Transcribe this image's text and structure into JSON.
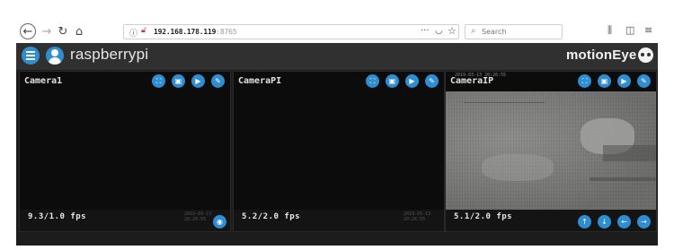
{
  "browser": {
    "url_host": "192.168.178.119",
    "url_port": ":8765",
    "url_more": "···",
    "search_placeholder": "Search",
    "icons": {
      "back": "arrow-left-icon",
      "forward": "arrow-right-icon",
      "reload": "reload-icon",
      "home": "home-icon",
      "info": "info-icon",
      "insecure": "insecure-lock-icon",
      "pocket": "pocket-icon",
      "bookmark": "star-icon",
      "library": "library-icon",
      "sidebar": "sidebar-icon",
      "menu": "hamburger-menu-icon"
    }
  },
  "header": {
    "hostname": "raspberrypi",
    "logo_text": "motionEye",
    "accent_color": "#2f8ed2",
    "background_color": "#303030"
  },
  "cameras": [
    {
      "name": "Camera1",
      "fps": "9.3/1.0 fps",
      "timestamp": "2019-03-13 20:26:55",
      "top_buttons": [
        "fullscreen-icon",
        "pictures-icon",
        "play-icon",
        "settings-icon"
      ],
      "bottom_buttons": [
        "snapshot-icon"
      ]
    },
    {
      "name": "CameraPI",
      "fps": "5.2/2.0 fps",
      "timestamp": "2019-03-13 20:26:55",
      "top_buttons": [
        "fullscreen-icon",
        "pictures-icon",
        "play-icon",
        "settings-icon"
      ],
      "bottom_buttons": []
    },
    {
      "name": "CameraIP",
      "fps": "5.1/2.0 fps",
      "overlay_timestamp": "2019-03-13 20:26:55",
      "top_buttons": [
        "fullscreen-icon",
        "pictures-icon",
        "play-icon",
        "settings-icon"
      ],
      "bottom_buttons": [
        "pan-up-icon",
        "pan-down-icon",
        "pan-left-icon",
        "pan-right-icon"
      ]
    }
  ]
}
